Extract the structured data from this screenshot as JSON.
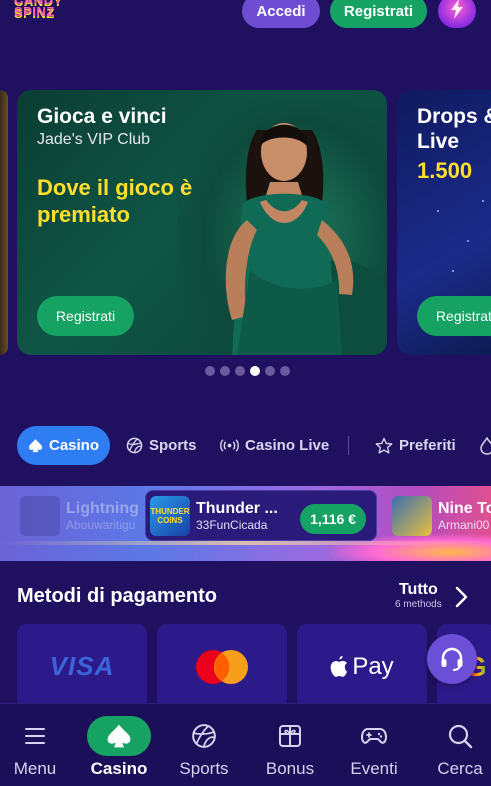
{
  "header": {
    "logo_text": "CANDY SPINZ",
    "login_label": "Accedi",
    "register_label": "Registrati"
  },
  "banners": [
    {
      "title": "Gioca e vinci",
      "subtitle": "Jade's VIP Club",
      "promo": "Dove il gioco è premiato",
      "cta": "Registrati"
    },
    {
      "title": "Drops & Live",
      "promo": "1.500",
      "cta": "Registrati"
    }
  ],
  "carousel": {
    "total": 6,
    "active": 3
  },
  "categories": {
    "casino": "Casino",
    "sports": "Sports",
    "live": "Casino Live",
    "favorites": "Preferiti"
  },
  "winners": [
    {
      "game": "Lightning",
      "user": "Abouwaritigu"
    },
    {
      "game": "Thunder ...",
      "user": "33FunCicada",
      "amount": "1,116 €",
      "thumb_text": "THUNDER COINS"
    },
    {
      "game": "Nine To",
      "user": "Armani00"
    }
  ],
  "payments": {
    "title": "Metodi di pagamento",
    "all_label": "Tutto",
    "count_label": "6 methods",
    "methods": [
      "VISA",
      "Mastercard",
      "Pay"
    ]
  },
  "bottom_nav": {
    "menu": "Menu",
    "casino": "Casino",
    "sports": "Sports",
    "bonus": "Bonus",
    "events": "Eventi",
    "search": "Cerca"
  },
  "colors": {
    "background": "#1f1160",
    "accent_green": "#16a263",
    "accent_purple": "#6e4dd3",
    "accent_blue": "#2f7df2",
    "promo_yellow": "#ffdf2e"
  }
}
